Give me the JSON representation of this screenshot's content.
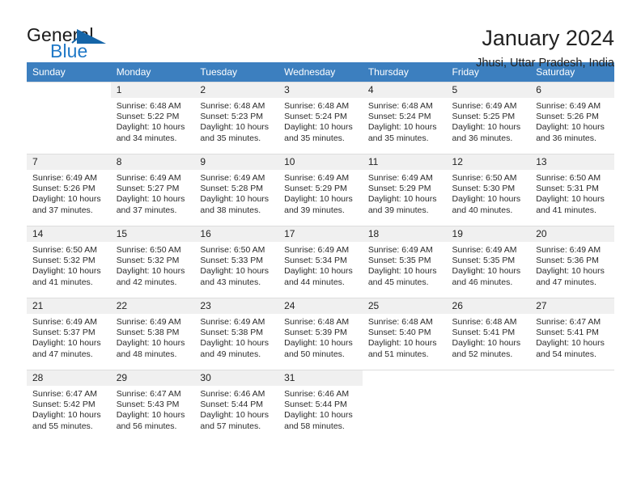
{
  "brand": {
    "word1": "General",
    "word2": "Blue",
    "triangle_icon": "triangle-icon",
    "accent_color": "#2079c7",
    "triangle_color": "#1565a8"
  },
  "header": {
    "title": "January 2024",
    "subtitle": "Jhusi, Uttar Pradesh, India"
  },
  "calendar": {
    "header_bg": "#3c7fbf",
    "header_text_color": "#ffffff",
    "weekday_headers": [
      "Sunday",
      "Monday",
      "Tuesday",
      "Wednesday",
      "Thursday",
      "Friday",
      "Saturday"
    ],
    "weeks": [
      [
        {
          "day": "",
          "sunrise": "",
          "sunset": "",
          "daylight1": "",
          "daylight2": "",
          "empty": true
        },
        {
          "day": "1",
          "sunrise": "Sunrise: 6:48 AM",
          "sunset": "Sunset: 5:22 PM",
          "daylight1": "Daylight: 10 hours",
          "daylight2": "and 34 minutes.",
          "empty": false
        },
        {
          "day": "2",
          "sunrise": "Sunrise: 6:48 AM",
          "sunset": "Sunset: 5:23 PM",
          "daylight1": "Daylight: 10 hours",
          "daylight2": "and 35 minutes.",
          "empty": false
        },
        {
          "day": "3",
          "sunrise": "Sunrise: 6:48 AM",
          "sunset": "Sunset: 5:24 PM",
          "daylight1": "Daylight: 10 hours",
          "daylight2": "and 35 minutes.",
          "empty": false
        },
        {
          "day": "4",
          "sunrise": "Sunrise: 6:48 AM",
          "sunset": "Sunset: 5:24 PM",
          "daylight1": "Daylight: 10 hours",
          "daylight2": "and 35 minutes.",
          "empty": false
        },
        {
          "day": "5",
          "sunrise": "Sunrise: 6:49 AM",
          "sunset": "Sunset: 5:25 PM",
          "daylight1": "Daylight: 10 hours",
          "daylight2": "and 36 minutes.",
          "empty": false
        },
        {
          "day": "6",
          "sunrise": "Sunrise: 6:49 AM",
          "sunset": "Sunset: 5:26 PM",
          "daylight1": "Daylight: 10 hours",
          "daylight2": "and 36 minutes.",
          "empty": false
        }
      ],
      [
        {
          "day": "7",
          "sunrise": "Sunrise: 6:49 AM",
          "sunset": "Sunset: 5:26 PM",
          "daylight1": "Daylight: 10 hours",
          "daylight2": "and 37 minutes.",
          "empty": false
        },
        {
          "day": "8",
          "sunrise": "Sunrise: 6:49 AM",
          "sunset": "Sunset: 5:27 PM",
          "daylight1": "Daylight: 10 hours",
          "daylight2": "and 37 minutes.",
          "empty": false
        },
        {
          "day": "9",
          "sunrise": "Sunrise: 6:49 AM",
          "sunset": "Sunset: 5:28 PM",
          "daylight1": "Daylight: 10 hours",
          "daylight2": "and 38 minutes.",
          "empty": false
        },
        {
          "day": "10",
          "sunrise": "Sunrise: 6:49 AM",
          "sunset": "Sunset: 5:29 PM",
          "daylight1": "Daylight: 10 hours",
          "daylight2": "and 39 minutes.",
          "empty": false
        },
        {
          "day": "11",
          "sunrise": "Sunrise: 6:49 AM",
          "sunset": "Sunset: 5:29 PM",
          "daylight1": "Daylight: 10 hours",
          "daylight2": "and 39 minutes.",
          "empty": false
        },
        {
          "day": "12",
          "sunrise": "Sunrise: 6:50 AM",
          "sunset": "Sunset: 5:30 PM",
          "daylight1": "Daylight: 10 hours",
          "daylight2": "and 40 minutes.",
          "empty": false
        },
        {
          "day": "13",
          "sunrise": "Sunrise: 6:50 AM",
          "sunset": "Sunset: 5:31 PM",
          "daylight1": "Daylight: 10 hours",
          "daylight2": "and 41 minutes.",
          "empty": false
        }
      ],
      [
        {
          "day": "14",
          "sunrise": "Sunrise: 6:50 AM",
          "sunset": "Sunset: 5:32 PM",
          "daylight1": "Daylight: 10 hours",
          "daylight2": "and 41 minutes.",
          "empty": false
        },
        {
          "day": "15",
          "sunrise": "Sunrise: 6:50 AM",
          "sunset": "Sunset: 5:32 PM",
          "daylight1": "Daylight: 10 hours",
          "daylight2": "and 42 minutes.",
          "empty": false
        },
        {
          "day": "16",
          "sunrise": "Sunrise: 6:50 AM",
          "sunset": "Sunset: 5:33 PM",
          "daylight1": "Daylight: 10 hours",
          "daylight2": "and 43 minutes.",
          "empty": false
        },
        {
          "day": "17",
          "sunrise": "Sunrise: 6:49 AM",
          "sunset": "Sunset: 5:34 PM",
          "daylight1": "Daylight: 10 hours",
          "daylight2": "and 44 minutes.",
          "empty": false
        },
        {
          "day": "18",
          "sunrise": "Sunrise: 6:49 AM",
          "sunset": "Sunset: 5:35 PM",
          "daylight1": "Daylight: 10 hours",
          "daylight2": "and 45 minutes.",
          "empty": false
        },
        {
          "day": "19",
          "sunrise": "Sunrise: 6:49 AM",
          "sunset": "Sunset: 5:35 PM",
          "daylight1": "Daylight: 10 hours",
          "daylight2": "and 46 minutes.",
          "empty": false
        },
        {
          "day": "20",
          "sunrise": "Sunrise: 6:49 AM",
          "sunset": "Sunset: 5:36 PM",
          "daylight1": "Daylight: 10 hours",
          "daylight2": "and 47 minutes.",
          "empty": false
        }
      ],
      [
        {
          "day": "21",
          "sunrise": "Sunrise: 6:49 AM",
          "sunset": "Sunset: 5:37 PM",
          "daylight1": "Daylight: 10 hours",
          "daylight2": "and 47 minutes.",
          "empty": false
        },
        {
          "day": "22",
          "sunrise": "Sunrise: 6:49 AM",
          "sunset": "Sunset: 5:38 PM",
          "daylight1": "Daylight: 10 hours",
          "daylight2": "and 48 minutes.",
          "empty": false
        },
        {
          "day": "23",
          "sunrise": "Sunrise: 6:49 AM",
          "sunset": "Sunset: 5:38 PM",
          "daylight1": "Daylight: 10 hours",
          "daylight2": "and 49 minutes.",
          "empty": false
        },
        {
          "day": "24",
          "sunrise": "Sunrise: 6:48 AM",
          "sunset": "Sunset: 5:39 PM",
          "daylight1": "Daylight: 10 hours",
          "daylight2": "and 50 minutes.",
          "empty": false
        },
        {
          "day": "25",
          "sunrise": "Sunrise: 6:48 AM",
          "sunset": "Sunset: 5:40 PM",
          "daylight1": "Daylight: 10 hours",
          "daylight2": "and 51 minutes.",
          "empty": false
        },
        {
          "day": "26",
          "sunrise": "Sunrise: 6:48 AM",
          "sunset": "Sunset: 5:41 PM",
          "daylight1": "Daylight: 10 hours",
          "daylight2": "and 52 minutes.",
          "empty": false
        },
        {
          "day": "27",
          "sunrise": "Sunrise: 6:47 AM",
          "sunset": "Sunset: 5:41 PM",
          "daylight1": "Daylight: 10 hours",
          "daylight2": "and 54 minutes.",
          "empty": false
        }
      ],
      [
        {
          "day": "28",
          "sunrise": "Sunrise: 6:47 AM",
          "sunset": "Sunset: 5:42 PM",
          "daylight1": "Daylight: 10 hours",
          "daylight2": "and 55 minutes.",
          "empty": false
        },
        {
          "day": "29",
          "sunrise": "Sunrise: 6:47 AM",
          "sunset": "Sunset: 5:43 PM",
          "daylight1": "Daylight: 10 hours",
          "daylight2": "and 56 minutes.",
          "empty": false
        },
        {
          "day": "30",
          "sunrise": "Sunrise: 6:46 AM",
          "sunset": "Sunset: 5:44 PM",
          "daylight1": "Daylight: 10 hours",
          "daylight2": "and 57 minutes.",
          "empty": false
        },
        {
          "day": "31",
          "sunrise": "Sunrise: 6:46 AM",
          "sunset": "Sunset: 5:44 PM",
          "daylight1": "Daylight: 10 hours",
          "daylight2": "and 58 minutes.",
          "empty": false
        },
        {
          "day": "",
          "sunrise": "",
          "sunset": "",
          "daylight1": "",
          "daylight2": "",
          "empty": true
        },
        {
          "day": "",
          "sunrise": "",
          "sunset": "",
          "daylight1": "",
          "daylight2": "",
          "empty": true
        },
        {
          "day": "",
          "sunrise": "",
          "sunset": "",
          "daylight1": "",
          "daylight2": "",
          "empty": true
        }
      ]
    ]
  }
}
